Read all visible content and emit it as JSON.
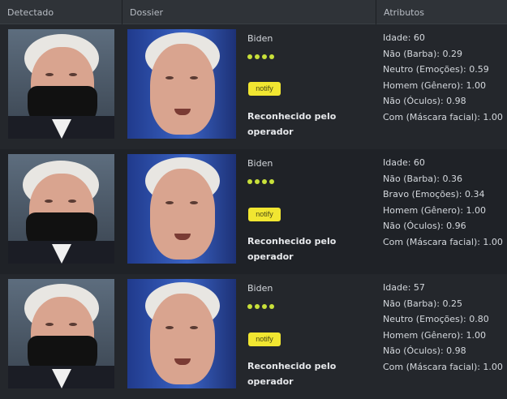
{
  "header": {
    "detected": "Detectado",
    "dossier": "Dossier",
    "attributes": "Atributos"
  },
  "rows": [
    {
      "name": "Biden",
      "notify_label": "notify",
      "status": "Reconhecido pelo operador",
      "attributes": [
        "Idade: 60",
        "Não (Barba): 0.29",
        "Neutro (Emoções): 0.59",
        "Homem (Gênero): 1.00",
        "Não (Óculos): 0.98",
        "Com (Máscara facial): 1.00"
      ]
    },
    {
      "name": "Biden",
      "notify_label": "notify",
      "status": "Reconhecido pelo operador",
      "attributes": [
        "Idade: 60",
        "Não (Barba): 0.36",
        "Bravo (Emoções): 0.34",
        "Homem (Gênero): 1.00",
        "Não (Óculos): 0.96",
        "Com (Máscara facial): 1.00"
      ]
    },
    {
      "name": "Biden",
      "notify_label": "notify",
      "status": "Reconhecido pelo operador",
      "attributes": [
        "Idade: 57",
        "Não (Barba): 0.25",
        "Neutro (Emoções): 0.80",
        "Homem (Gênero): 1.00",
        "Não (Óculos): 0.98",
        "Com (Máscara facial): 1.00"
      ]
    }
  ],
  "colors": {
    "notify": "#f1e631",
    "dots": "#c8e03a",
    "header": "#2f3338"
  }
}
